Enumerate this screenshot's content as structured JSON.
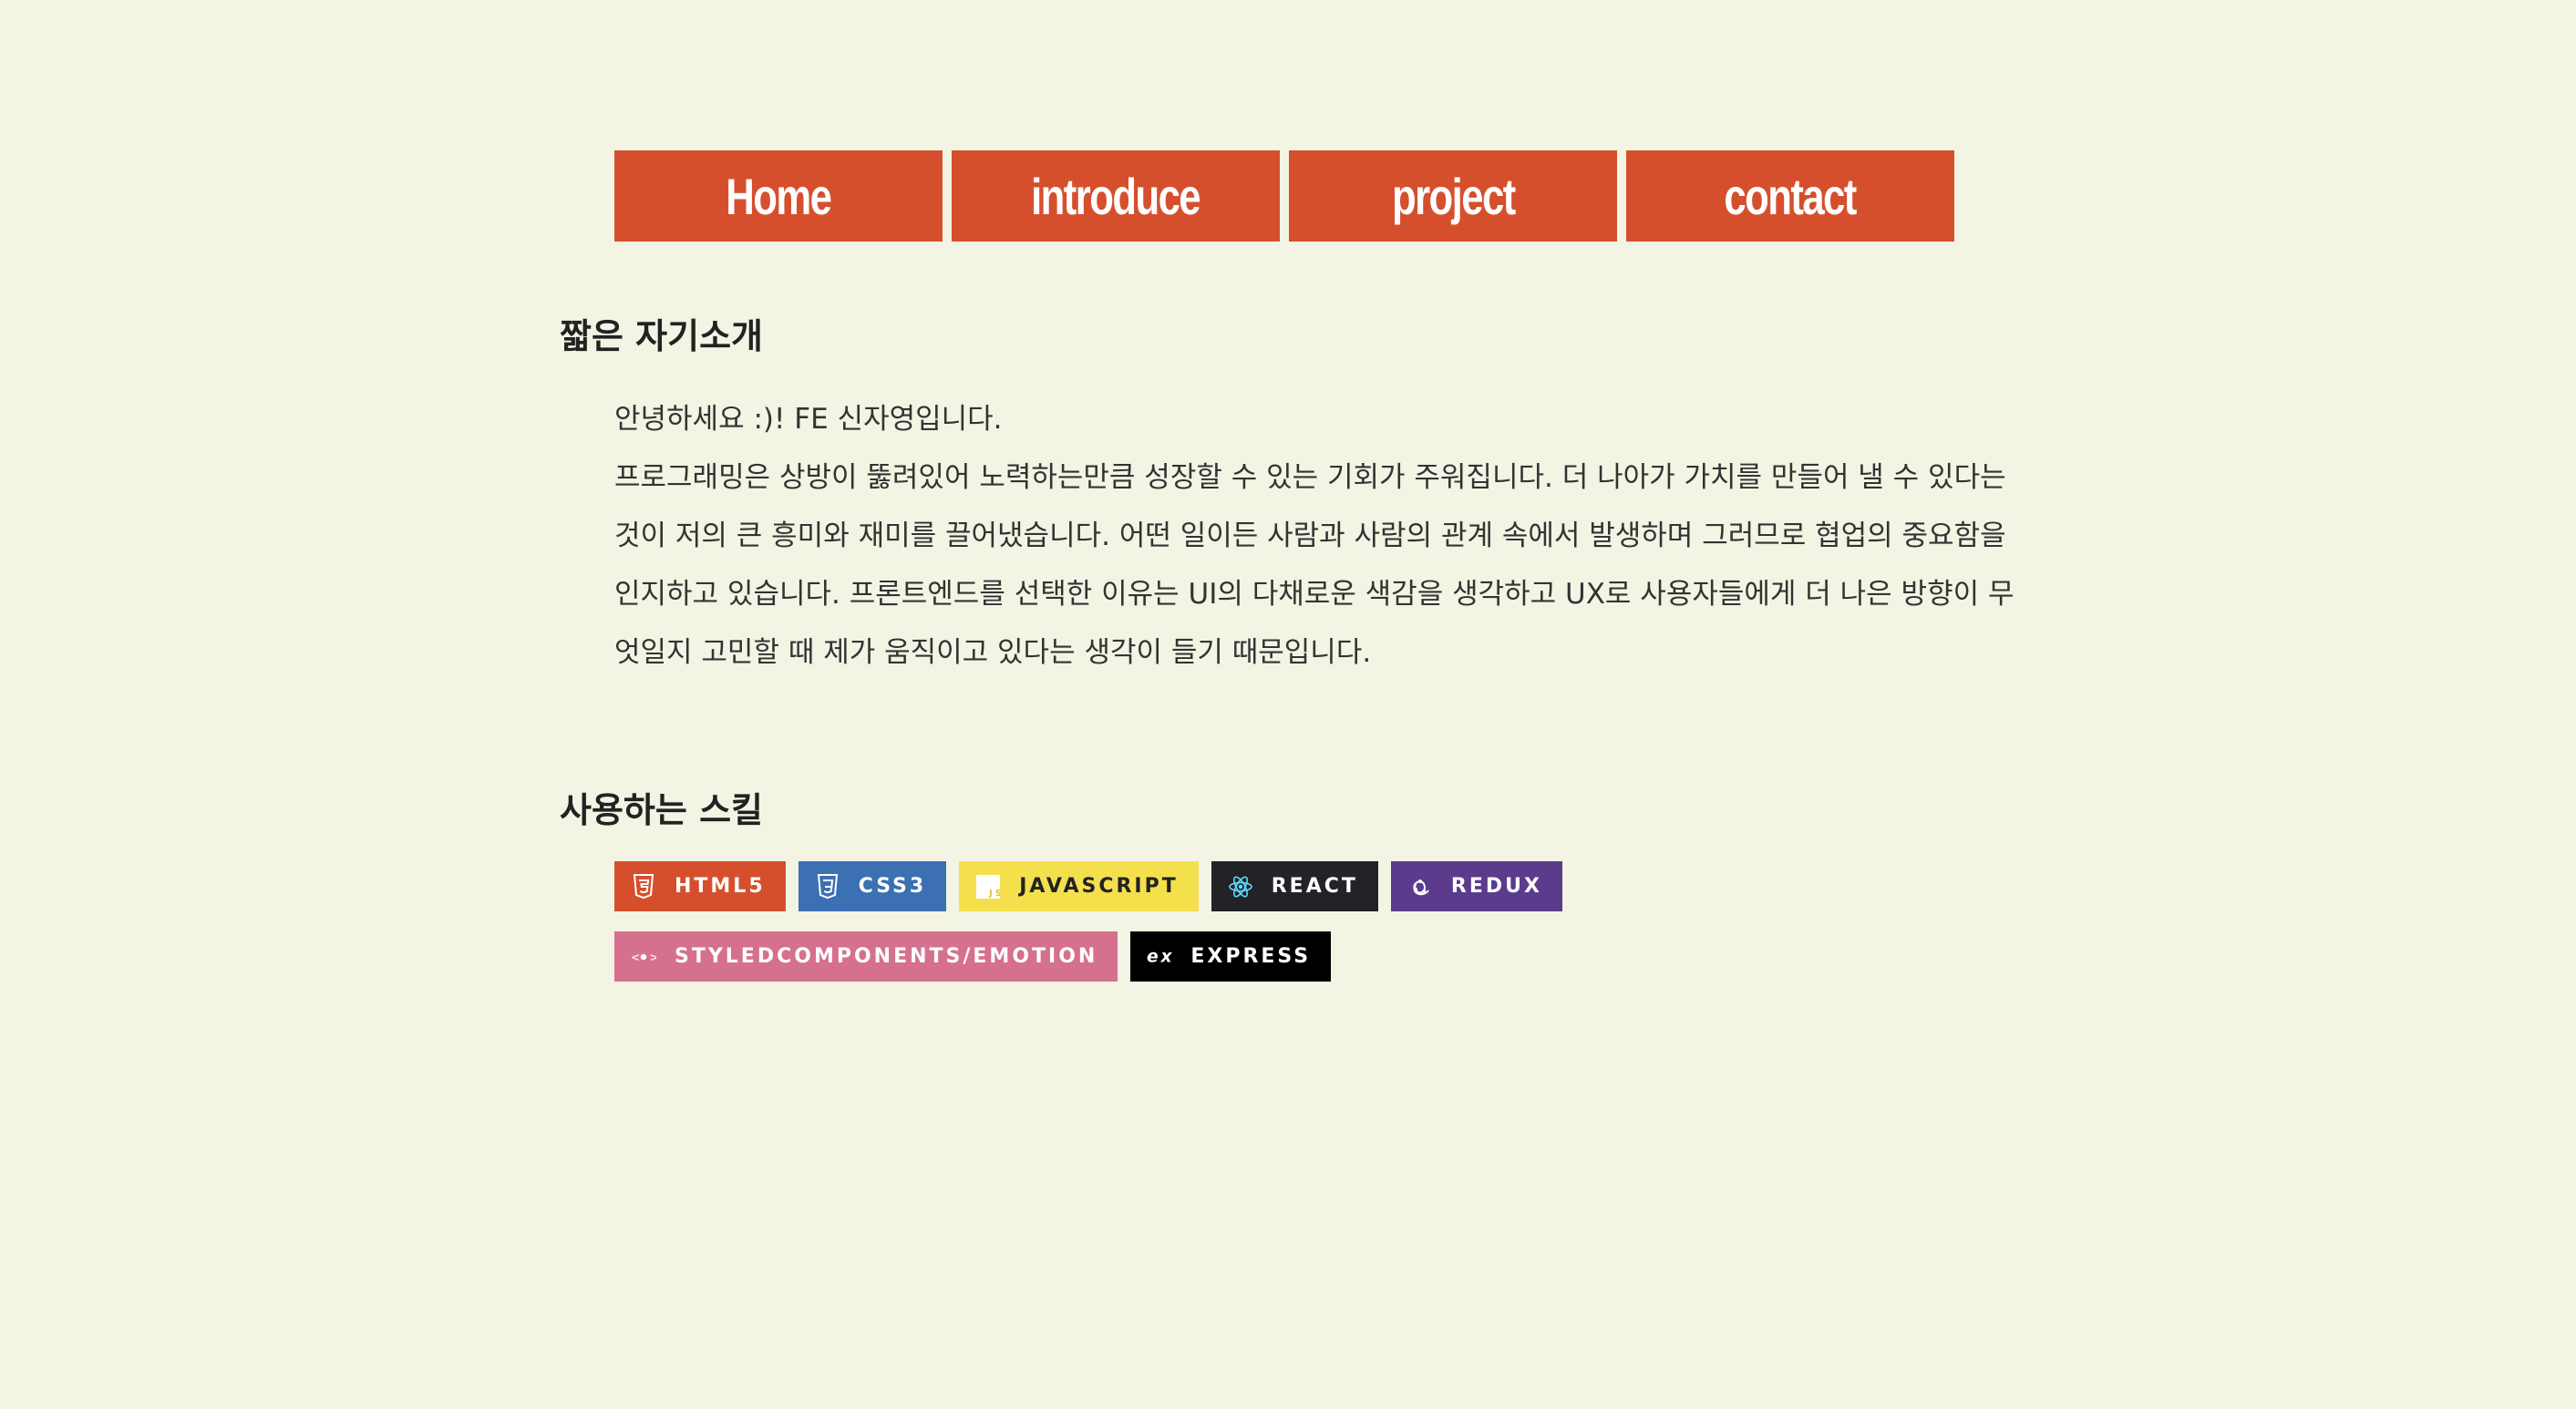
{
  "nav": {
    "items": [
      {
        "label": "Home"
      },
      {
        "label": "introduce"
      },
      {
        "label": "project"
      },
      {
        "label": "contact"
      }
    ]
  },
  "intro": {
    "title": "짧은 자기소개",
    "greeting": "안녕하세요 :)! FE 신자영입니다.",
    "body": "프로그래밍은 상방이 뚫려있어 노력하는만큼 성장할 수 있는 기회가 주워집니다. 더 나아가 가치를 만들어 낼 수 있다는 것이 저의 큰 흥미와 재미를 끌어냈습니다. 어떤 일이든 사람과 사람의 관계 속에서 발생하며 그러므로 협업의 중요함을 인지하고 있습니다. 프론트엔드를 선택한 이유는 UI의 다채로운 색감을 생각하고 UX로 사용자들에게 더 나은 방향이 무엇일지 고민할 때 제가 움직이고 있다는 생각이 들기 때문입니다."
  },
  "skills": {
    "title": "사용하는 스킬",
    "badges": [
      {
        "label": "HTML5",
        "icon": "html5-icon",
        "color": "#d64f2d"
      },
      {
        "label": "CSS3",
        "icon": "css3-icon",
        "color": "#3b70b3"
      },
      {
        "label": "JAVASCRIPT",
        "icon": "javascript-icon",
        "color": "#f4e04d"
      },
      {
        "label": "REACT",
        "icon": "react-icon",
        "color": "#212327"
      },
      {
        "label": "REDUX",
        "icon": "redux-icon",
        "color": "#5b3b8c"
      },
      {
        "label": "STYLEDCOMPONENTS/EMOTION",
        "icon": "styled-components-icon",
        "color": "#d6708f"
      },
      {
        "label": "EXPRESS",
        "icon": "express-icon",
        "color": "#000000"
      }
    ]
  },
  "colors": {
    "background": "#f3f4e3",
    "accent": "#d64f2d"
  }
}
